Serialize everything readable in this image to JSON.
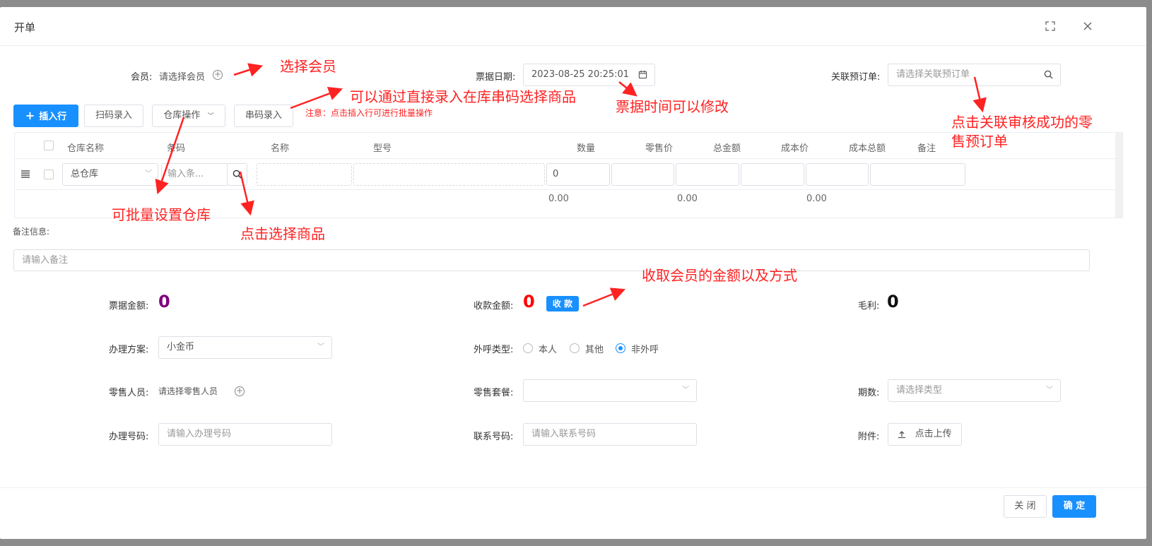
{
  "modal": {
    "title": "开单",
    "close_label": "关 闭",
    "confirm_label": "确 定"
  },
  "top_form": {
    "member_label": "会员:",
    "member_value": "请选择会员",
    "date_label": "票据日期:",
    "date_value": "2023-08-25 20:25:01",
    "order_label": "关联预订单:",
    "order_placeholder": "请选择关联预订单"
  },
  "toolbar": {
    "insert_row": "插入行",
    "scan_entry": "扫码录入",
    "warehouse_ops": "仓库操作",
    "serial_entry": "串码录入",
    "note": "注意：点击插入行可进行批量操作"
  },
  "table": {
    "headers": [
      "仓库名称",
      "条码",
      "名称",
      "型号",
      "数量",
      "零售价",
      "总金额",
      "成本价",
      "成本总额",
      "备注"
    ],
    "row": {
      "warehouse": "总仓库",
      "barcode_placeholder": "输入条...",
      "quantity": "0"
    },
    "totals": [
      "0.00",
      "0.00",
      "0.00"
    ]
  },
  "remark": {
    "label": "备注信息:",
    "placeholder": "请输入备注"
  },
  "amounts": {
    "bill_label": "票据金额:",
    "bill_value": "0",
    "receive_label": "收款金额:",
    "receive_value": "0",
    "receive_button": "收 款",
    "profit_label": "毛利:",
    "profit_value": "0"
  },
  "details": {
    "plan_label": "办理方案:",
    "plan_value": "小金币",
    "call_type_label": "外呼类型:",
    "call_options": [
      "本人",
      "其他",
      "非外呼"
    ],
    "call_selected": "非外呼",
    "sales_person_label": "零售人员:",
    "sales_person_value": "请选择零售人员",
    "package_label": "零售套餐:",
    "package_value": "",
    "period_label": "期数:",
    "period_placeholder": "请选择类型",
    "handle_no_label": "办理号码:",
    "handle_no_placeholder": "请输入办理号码",
    "contact_label": "联系号码:",
    "contact_placeholder": "请输入联系号码",
    "attach_label": "附件:",
    "upload_label": "点击上传"
  },
  "annotations": {
    "select_member": "选择会员",
    "serial_tip": "可以通过直接录入在库串码选择商品",
    "date_tip": "票据时间可以修改",
    "order_tip_line1": "点击关联审核成功的零",
    "order_tip_line2": "售预订单",
    "warehouse_tip": "可批量设置仓库",
    "product_tip": "点击选择商品",
    "payment_tip": "收取会员的金额以及方式"
  },
  "colors": {
    "primary": "#1890ff",
    "annotation": "#ff2222",
    "bill_amount": "#800080",
    "receive_amount": "#ff0000"
  }
}
